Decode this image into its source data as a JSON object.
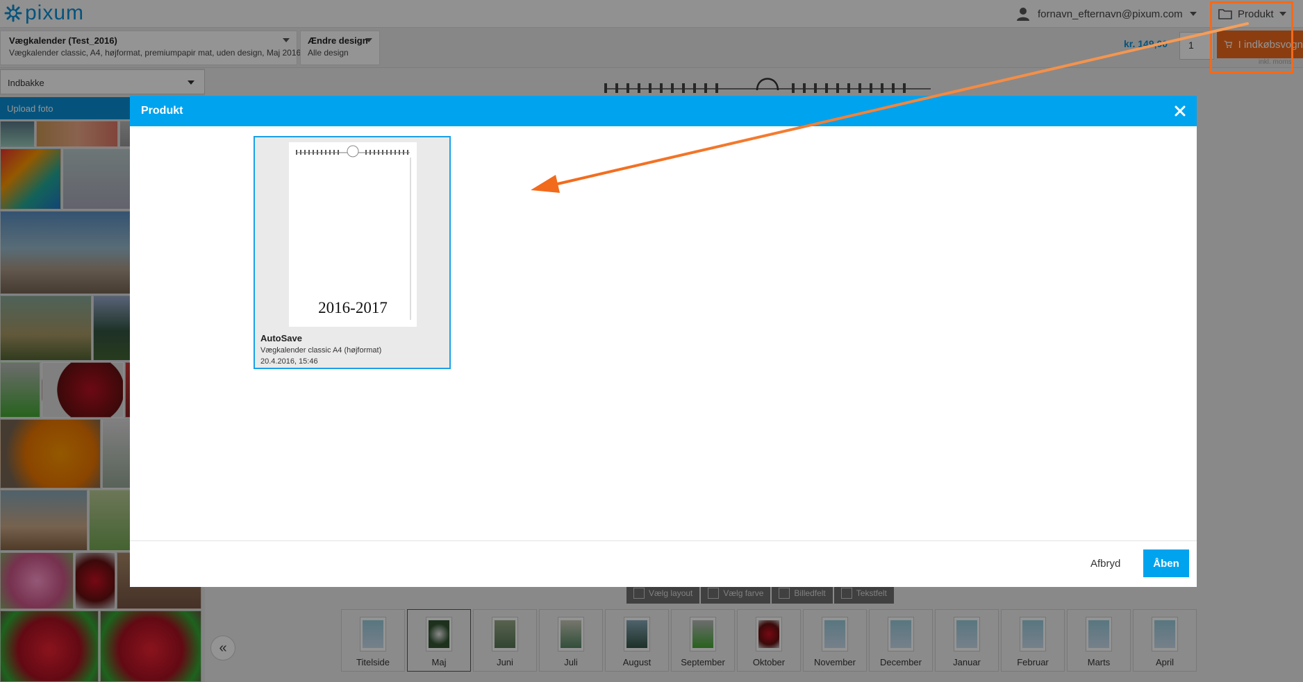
{
  "header": {
    "logo_text": "pixum",
    "user_email": "fornavn_efternavn@pixum.com",
    "product_menu_label": "Produkt"
  },
  "product_bar": {
    "product_title": "Vægkalender (Test_2016)",
    "product_subtitle": "Vægkalender classic, A4, højformat, premiumpapir mat, uden design, Maj 2016",
    "design_title": "Ændre design",
    "design_subtitle": "Alle design",
    "price": "kr. 149,00",
    "quantity": "1",
    "cart_label": "I indkøbsvogn",
    "cart_note": "inkl. moms"
  },
  "sidebar": {
    "folder_select": "Indbakke",
    "upload_label": "Upload foto"
  },
  "toolbar": {
    "layout_label": "Vælg layout",
    "color_label": "Vælg farve",
    "image_field_label": "Billedfelt",
    "text_field_label": "Tekstfelt"
  },
  "thumbnails": {
    "collapse_label": "«",
    "pages": [
      {
        "label": "Titelside"
      },
      {
        "label": "Maj"
      },
      {
        "label": "Juni"
      },
      {
        "label": "Juli"
      },
      {
        "label": "August"
      },
      {
        "label": "September"
      },
      {
        "label": "Oktober"
      },
      {
        "label": "November"
      },
      {
        "label": "December"
      },
      {
        "label": "Januar"
      },
      {
        "label": "Februar"
      },
      {
        "label": "Marts"
      },
      {
        "label": "April"
      }
    ]
  },
  "modal": {
    "title": "Produkt",
    "close_icon": "close-icon",
    "card": {
      "year": "2016-2017",
      "name": "AutoSave",
      "description": "Vægkalender classic A4 (højformat)",
      "date": "20.4.2016, 15:46"
    },
    "cancel_label": "Afbryd",
    "open_label": "Åben"
  },
  "colors": {
    "accent": "#00a3ee",
    "cart": "#f26a1b",
    "annotation": "#f26a1b"
  }
}
